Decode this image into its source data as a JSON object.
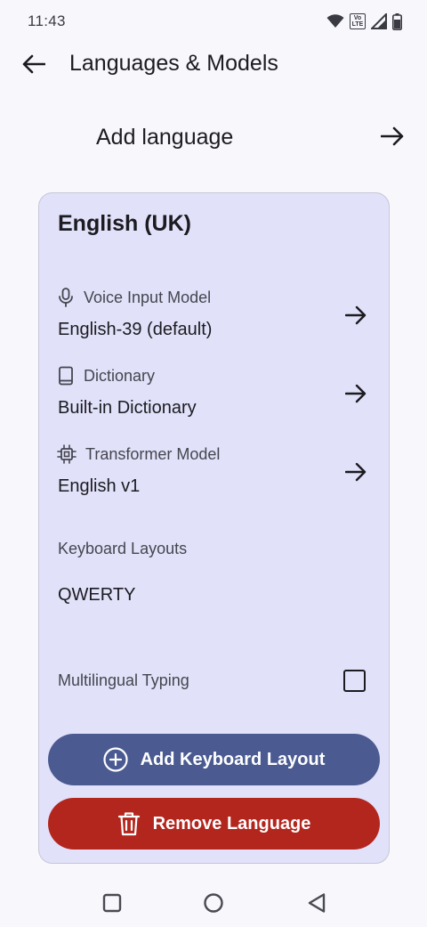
{
  "status_bar": {
    "time": "11:43",
    "volte_top": "Vo",
    "volte_bottom": "LTE"
  },
  "top_bar": {
    "title": "Languages & Models",
    "back_icon": "arrow-back-icon"
  },
  "add_language": {
    "label": "Add language",
    "icon": "arrow-forward-icon"
  },
  "language_card": {
    "name": "English (UK)",
    "settings": [
      {
        "icon": "microphone-icon",
        "label": "Voice Input Model",
        "value": "English-39 (default)"
      },
      {
        "icon": "book-icon",
        "label": "Dictionary",
        "value": "Built-in Dictionary"
      },
      {
        "icon": "chip-icon",
        "label": "Transformer Model",
        "value": "English v1"
      }
    ],
    "keyboard_layouts_label": "Keyboard Layouts",
    "keyboard_layouts": [
      "QWERTY"
    ],
    "multilingual_typing_label": "Multilingual Typing",
    "multilingual_typing_checked": false,
    "add_layout_button": "Add Keyboard Layout",
    "remove_language_button": "Remove Language"
  },
  "colors": {
    "background": "#f7f7fc",
    "card": "#e1e1f9",
    "add_button": "#4b5b91",
    "remove_button": "#b3261e"
  },
  "nav_bar": {
    "icons": [
      "recents-square-icon",
      "home-circle-icon",
      "back-triangle-icon"
    ]
  }
}
